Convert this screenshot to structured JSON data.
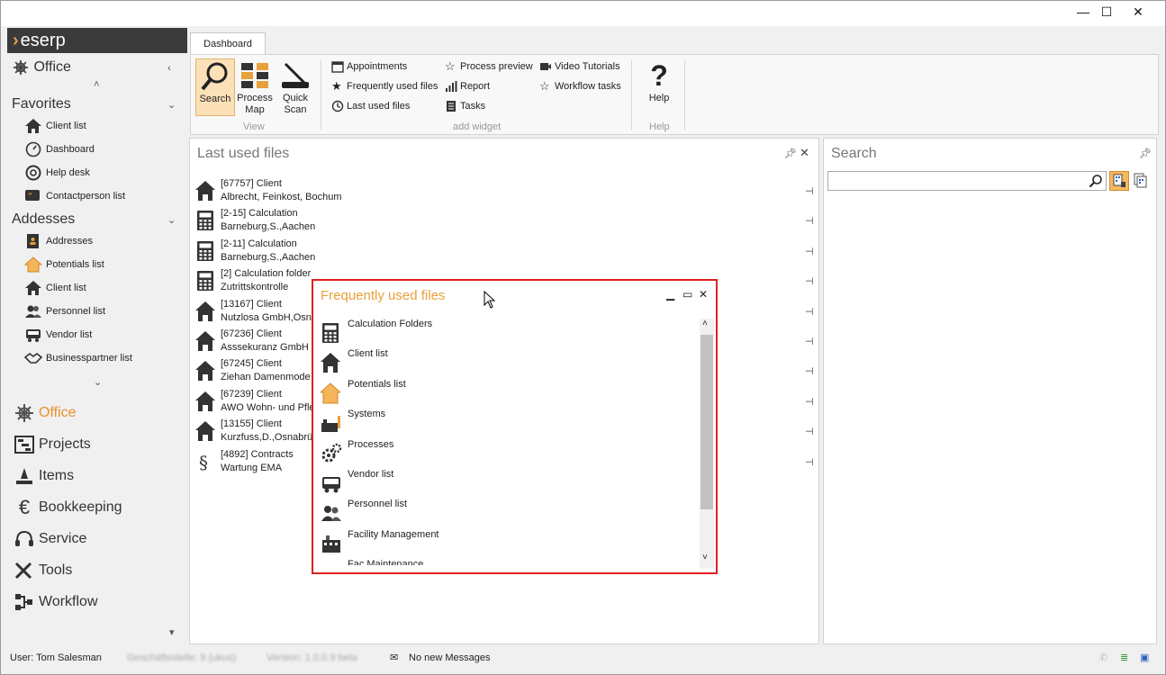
{
  "logo": {
    "text": "eserp"
  },
  "window": {
    "minimize": "—",
    "maximize": "☐",
    "close": "✕"
  },
  "sidebar": {
    "office_header": "Office",
    "favorites": {
      "title": "Favorites",
      "items": [
        {
          "label": "Client list",
          "icon": "house-icon"
        },
        {
          "label": "Dashboard",
          "icon": "gauge-icon"
        },
        {
          "label": "Help desk",
          "icon": "lifebuoy-icon"
        },
        {
          "label": "Contactperson list",
          "icon": "quote-icon"
        }
      ]
    },
    "addresses": {
      "title": "Addesses",
      "items": [
        {
          "label": "Addresses",
          "icon": "address-book-icon"
        },
        {
          "label": "Potentials list",
          "icon": "house-outline-icon"
        },
        {
          "label": "Client list",
          "icon": "house-icon"
        },
        {
          "label": "Personnel list",
          "icon": "people-icon"
        },
        {
          "label": "Vendor list",
          "icon": "truck-icon"
        },
        {
          "label": "Businesspartner list",
          "icon": "handshake-icon"
        }
      ]
    },
    "nav": [
      {
        "label": "Office",
        "icon": "helm-icon",
        "active": true
      },
      {
        "label": "Projects",
        "icon": "projects-icon",
        "active": false
      },
      {
        "label": "Items",
        "icon": "items-icon",
        "active": false
      },
      {
        "label": "Bookkeeping",
        "icon": "euro-icon",
        "active": false
      },
      {
        "label": "Service",
        "icon": "headset-icon",
        "active": false
      },
      {
        "label": "Tools",
        "icon": "tools-icon",
        "active": false
      },
      {
        "label": "Workflow",
        "icon": "workflow-icon",
        "active": false
      }
    ]
  },
  "ribbon": {
    "tab": "Dashboard",
    "view": {
      "group": "View",
      "search": "Search",
      "process_map": "Process Map",
      "quick_scan": "Quick Scan"
    },
    "add_widget": {
      "group": "add widget",
      "appointments": "Appointments",
      "frequently_used": "Frequently used files",
      "last_used": "Last used files",
      "process_preview": "Process preview",
      "report": "Report",
      "tasks": "Tasks",
      "video_tutorials": "Video Tutorials",
      "workflow_tasks": "Workflow tasks"
    },
    "help": {
      "group": "Help",
      "help": "Help"
    }
  },
  "last_used": {
    "title": "Last used files",
    "rows": [
      {
        "line1": "[67757] Client",
        "line2": "Albrecht, Feinkost, Bochum",
        "icon": "house-icon"
      },
      {
        "line1": "[2-15] Calculation",
        "line2": "Barneburg,S.,Aachen",
        "icon": "calculator-icon"
      },
      {
        "line1": "[2-11] Calculation",
        "line2": "Barneburg,S.,Aachen",
        "icon": "calculator-icon"
      },
      {
        "line1": "[2] Calculation folder",
        "line2": "Zutrittskontrolle",
        "icon": "calculator-icon"
      },
      {
        "line1": "[13167] Client",
        "line2": "Nutzlosa GmbH,Osna",
        "icon": "house-icon"
      },
      {
        "line1": "[67236] Client",
        "line2": "Asssekuranz GmbH &",
        "icon": "house-icon"
      },
      {
        "line1": "[67245] Client",
        "line2": "Ziehan Damenmode",
        "icon": "house-icon"
      },
      {
        "line1": "[67239] Client",
        "line2": "AWO Wohn- und Pfle",
        "icon": "house-icon"
      },
      {
        "line1": "[13155] Client",
        "line2": "Kurzfuss,D.,Osnabrü",
        "icon": "house-icon"
      },
      {
        "line1": "[4892] Contracts",
        "line2": "Wartung EMA",
        "icon": "paragraph-icon"
      }
    ]
  },
  "search_panel": {
    "title": "Search",
    "placeholder": ""
  },
  "frequently_used": {
    "title": "Frequently used files",
    "items": [
      {
        "label": "Calculation Folders",
        "icon": "calculator-icon"
      },
      {
        "label": "Client list",
        "icon": "house-icon"
      },
      {
        "label": "Potentials list",
        "icon": "house-outline-icon"
      },
      {
        "label": "Systems",
        "icon": "systems-icon"
      },
      {
        "label": "Processes",
        "icon": "gears-icon"
      },
      {
        "label": "Vendor list",
        "icon": "truck-icon"
      },
      {
        "label": "Personnel list",
        "icon": "people-icon"
      },
      {
        "label": "Facility Management",
        "icon": "facility-icon"
      },
      {
        "label": "Fac Maintenance",
        "icon": "maintenance-icon"
      }
    ]
  },
  "status": {
    "user": "User: Tom Salesman",
    "branch": "Geschäftsstelle: 9 (ukus)",
    "version": "Version: 1.0.0.9 beta",
    "messages": "No new Messages"
  },
  "colors": {
    "accent": "#e8912a",
    "popup_border": "#e02020",
    "logo_bg": "#3a3a3a"
  }
}
